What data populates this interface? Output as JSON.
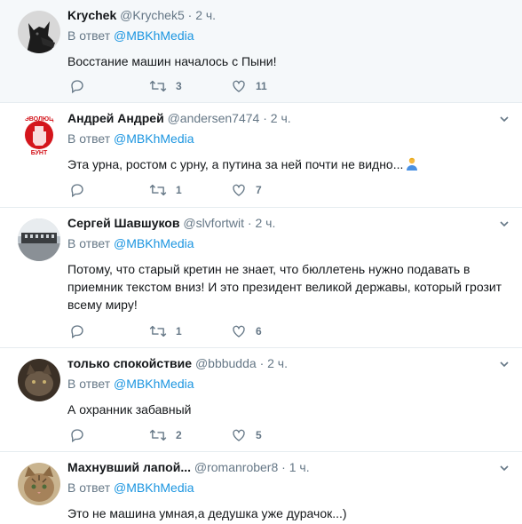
{
  "tweets": [
    {
      "name": "Krychek",
      "handle": "@Krychek5",
      "dot": "·",
      "time": "2 ч.",
      "reply_prefix": "В ответ",
      "reply_to": "@MBKhMedia",
      "text": "Восстание машин началось с Пыни!",
      "replies": "",
      "retweets": "3",
      "likes": "11",
      "avatar": "dog-avatar",
      "show_chevron": false
    },
    {
      "name": "Андрей Андрей",
      "handle": "@andersen7474",
      "dot": "·",
      "time": "2 ч.",
      "reply_prefix": "В ответ",
      "reply_to": "@MBKhMedia",
      "text": "Эта урна, ростом с урну, а путина за ней почти не видно...",
      "text_emoji": "person-shrugging-emoji",
      "replies": "",
      "retweets": "1",
      "likes": "7",
      "avatar": "revolution-logo-avatar",
      "show_chevron": true
    },
    {
      "name": "Сергей Шавшуков",
      "handle": "@slvfortwit",
      "dot": "·",
      "time": "2 ч.",
      "reply_prefix": "В ответ",
      "reply_to": "@MBKhMedia",
      "text": "Потому, что старый кретин не знает, что бюллетень нужно подавать в приемник текстом вниз! И это президент великой державы, который грозит всему миру!",
      "replies": "",
      "retweets": "1",
      "likes": "6",
      "avatar": "city-photo-avatar",
      "show_chevron": true
    },
    {
      "name": "только спокойствие",
      "handle": "@bbbudda",
      "dot": "·",
      "time": "2 ч.",
      "reply_prefix": "В ответ",
      "reply_to": "@MBKhMedia",
      "text": "А охранник забавный",
      "replies": "",
      "retweets": "2",
      "likes": "5",
      "avatar": "cat-dark-avatar",
      "show_chevron": true
    },
    {
      "name": "Махнувший лапой...",
      "handle": "@romanrober8",
      "dot": "·",
      "time": "1 ч.",
      "reply_prefix": "В ответ",
      "reply_to": "@MBKhMedia",
      "text": "Это не машина умная,а дедушка уже дурачок...)",
      "replies": "",
      "retweets": "",
      "likes": "",
      "avatar": "tabby-cat-avatar",
      "show_chevron": true
    }
  ],
  "colors": {
    "link": "#1b95e0",
    "muted": "#657786",
    "text": "#14171a",
    "highlight_bg": "#f5f8fa",
    "divider": "#e6ecf0"
  }
}
